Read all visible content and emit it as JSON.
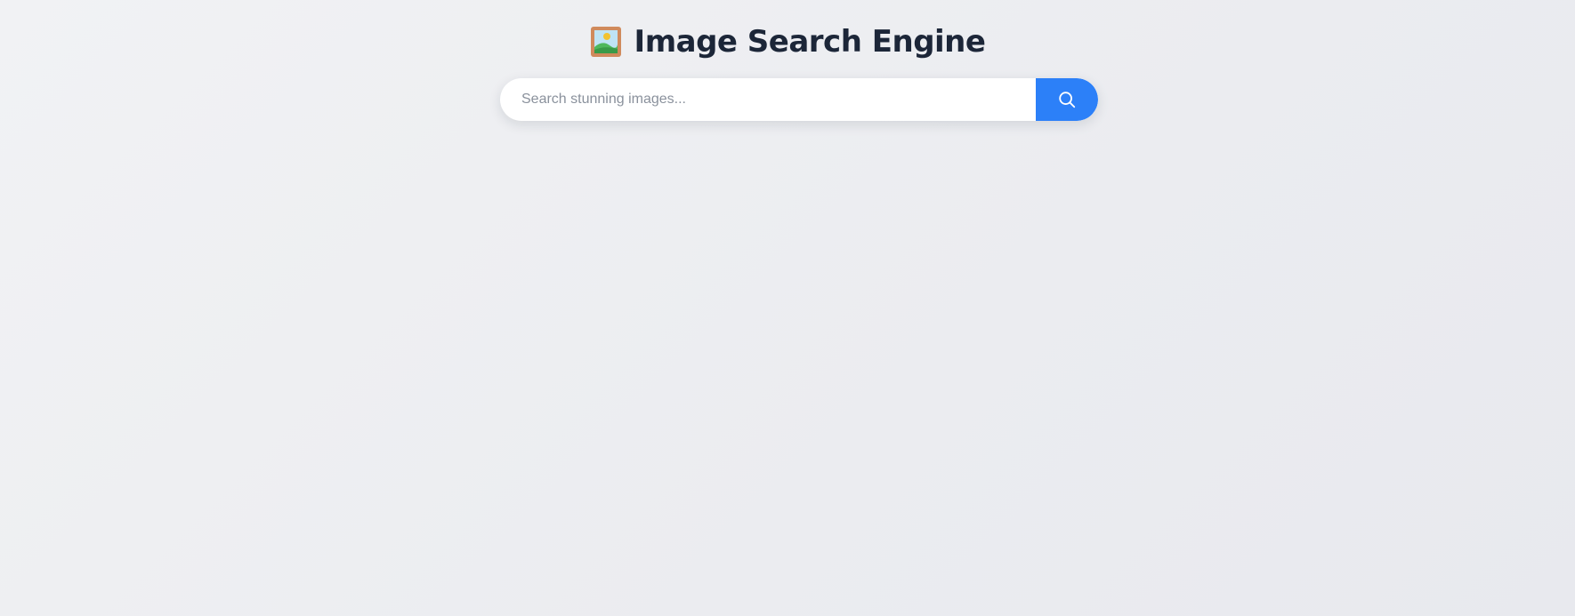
{
  "header": {
    "logo_icon": "framed-picture-icon",
    "title": "Image Search Engine"
  },
  "search": {
    "value": "",
    "placeholder": "Search stunning images...",
    "button_icon": "search-icon"
  },
  "colors": {
    "accent": "#2c80f8",
    "title": "#1c2638",
    "background": "#eceef1"
  }
}
